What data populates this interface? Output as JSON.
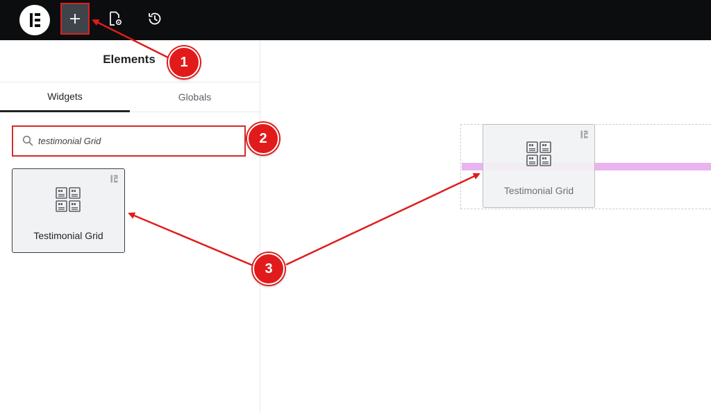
{
  "toolbar": {
    "logo_icon": "elementor-logo-icon",
    "add_icon": "plus-icon",
    "page_settings_icon": "document-settings-icon",
    "history_icon": "history-icon"
  },
  "panel": {
    "title": "Elements",
    "tabs": [
      {
        "label": "Widgets",
        "active": true
      },
      {
        "label": "Globals",
        "active": false
      }
    ],
    "search": {
      "value": "testimonial Grid",
      "icon": "search-icon"
    },
    "widget": {
      "label": "Testimonial Grid",
      "icon": "testimonial-grid-icon",
      "badge_icon": "pro-badge-icon"
    }
  },
  "canvas": {
    "dragged_widget": {
      "label": "Testimonial Grid",
      "icon": "testimonial-grid-icon"
    }
  },
  "annotations": {
    "steps": [
      "1",
      "2",
      "3"
    ],
    "color": "#e11b1b"
  }
}
